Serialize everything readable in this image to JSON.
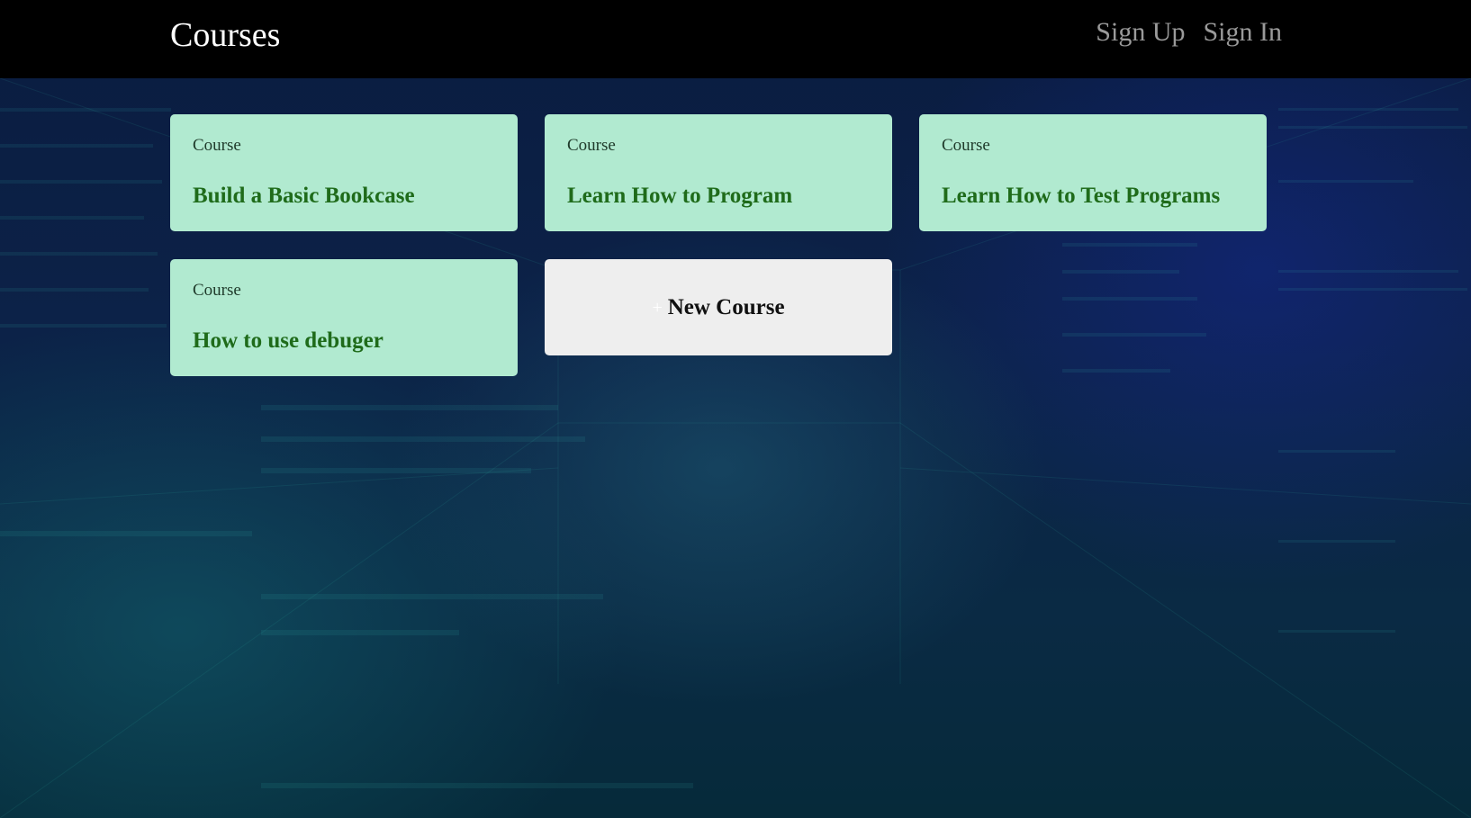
{
  "header": {
    "title": "Courses",
    "links": [
      "Sign Up",
      "Sign In"
    ]
  },
  "courses": [
    {
      "kicker": "Course",
      "title": "Build a Basic Bookcase"
    },
    {
      "kicker": "Course",
      "title": "Learn How to Program"
    },
    {
      "kicker": "Course",
      "title": "Learn How to Test Programs"
    },
    {
      "kicker": "Course",
      "title": "How to use debuger"
    }
  ],
  "new_course": {
    "icon": "plus-icon",
    "label": "New Course"
  },
  "colors": {
    "navbar": "#000000",
    "card_bg": "#b1ead0",
    "card_title": "#1f6b1a",
    "new_card_bg": "#eeeeee"
  }
}
